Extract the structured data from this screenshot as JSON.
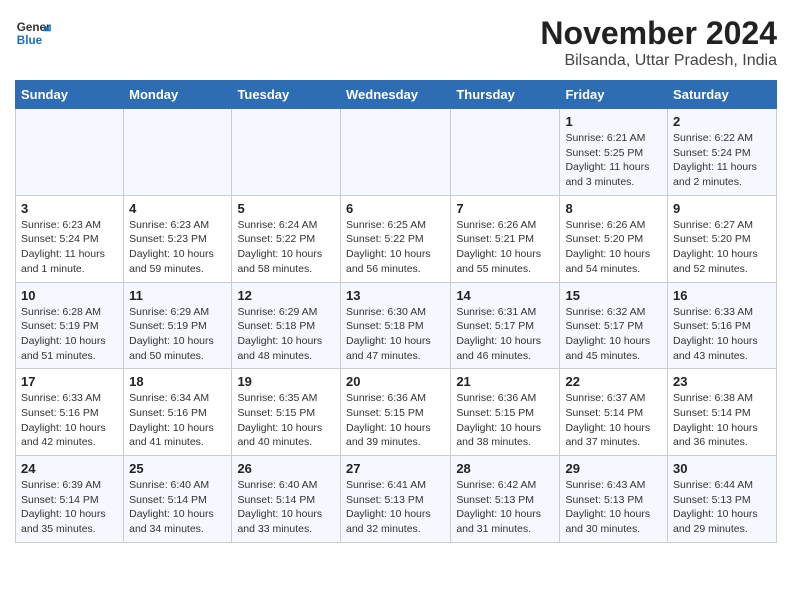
{
  "header": {
    "logo_line1": "General",
    "logo_line2": "Blue",
    "title": "November 2024",
    "subtitle": "Bilsanda, Uttar Pradesh, India"
  },
  "weekdays": [
    "Sunday",
    "Monday",
    "Tuesday",
    "Wednesday",
    "Thursday",
    "Friday",
    "Saturday"
  ],
  "weeks": [
    [
      {
        "num": "",
        "info": ""
      },
      {
        "num": "",
        "info": ""
      },
      {
        "num": "",
        "info": ""
      },
      {
        "num": "",
        "info": ""
      },
      {
        "num": "",
        "info": ""
      },
      {
        "num": "1",
        "info": "Sunrise: 6:21 AM\nSunset: 5:25 PM\nDaylight: 11 hours and 3 minutes."
      },
      {
        "num": "2",
        "info": "Sunrise: 6:22 AM\nSunset: 5:24 PM\nDaylight: 11 hours and 2 minutes."
      }
    ],
    [
      {
        "num": "3",
        "info": "Sunrise: 6:23 AM\nSunset: 5:24 PM\nDaylight: 11 hours and 1 minute."
      },
      {
        "num": "4",
        "info": "Sunrise: 6:23 AM\nSunset: 5:23 PM\nDaylight: 10 hours and 59 minutes."
      },
      {
        "num": "5",
        "info": "Sunrise: 6:24 AM\nSunset: 5:22 PM\nDaylight: 10 hours and 58 minutes."
      },
      {
        "num": "6",
        "info": "Sunrise: 6:25 AM\nSunset: 5:22 PM\nDaylight: 10 hours and 56 minutes."
      },
      {
        "num": "7",
        "info": "Sunrise: 6:26 AM\nSunset: 5:21 PM\nDaylight: 10 hours and 55 minutes."
      },
      {
        "num": "8",
        "info": "Sunrise: 6:26 AM\nSunset: 5:20 PM\nDaylight: 10 hours and 54 minutes."
      },
      {
        "num": "9",
        "info": "Sunrise: 6:27 AM\nSunset: 5:20 PM\nDaylight: 10 hours and 52 minutes."
      }
    ],
    [
      {
        "num": "10",
        "info": "Sunrise: 6:28 AM\nSunset: 5:19 PM\nDaylight: 10 hours and 51 minutes."
      },
      {
        "num": "11",
        "info": "Sunrise: 6:29 AM\nSunset: 5:19 PM\nDaylight: 10 hours and 50 minutes."
      },
      {
        "num": "12",
        "info": "Sunrise: 6:29 AM\nSunset: 5:18 PM\nDaylight: 10 hours and 48 minutes."
      },
      {
        "num": "13",
        "info": "Sunrise: 6:30 AM\nSunset: 5:18 PM\nDaylight: 10 hours and 47 minutes."
      },
      {
        "num": "14",
        "info": "Sunrise: 6:31 AM\nSunset: 5:17 PM\nDaylight: 10 hours and 46 minutes."
      },
      {
        "num": "15",
        "info": "Sunrise: 6:32 AM\nSunset: 5:17 PM\nDaylight: 10 hours and 45 minutes."
      },
      {
        "num": "16",
        "info": "Sunrise: 6:33 AM\nSunset: 5:16 PM\nDaylight: 10 hours and 43 minutes."
      }
    ],
    [
      {
        "num": "17",
        "info": "Sunrise: 6:33 AM\nSunset: 5:16 PM\nDaylight: 10 hours and 42 minutes."
      },
      {
        "num": "18",
        "info": "Sunrise: 6:34 AM\nSunset: 5:16 PM\nDaylight: 10 hours and 41 minutes."
      },
      {
        "num": "19",
        "info": "Sunrise: 6:35 AM\nSunset: 5:15 PM\nDaylight: 10 hours and 40 minutes."
      },
      {
        "num": "20",
        "info": "Sunrise: 6:36 AM\nSunset: 5:15 PM\nDaylight: 10 hours and 39 minutes."
      },
      {
        "num": "21",
        "info": "Sunrise: 6:36 AM\nSunset: 5:15 PM\nDaylight: 10 hours and 38 minutes."
      },
      {
        "num": "22",
        "info": "Sunrise: 6:37 AM\nSunset: 5:14 PM\nDaylight: 10 hours and 37 minutes."
      },
      {
        "num": "23",
        "info": "Sunrise: 6:38 AM\nSunset: 5:14 PM\nDaylight: 10 hours and 36 minutes."
      }
    ],
    [
      {
        "num": "24",
        "info": "Sunrise: 6:39 AM\nSunset: 5:14 PM\nDaylight: 10 hours and 35 minutes."
      },
      {
        "num": "25",
        "info": "Sunrise: 6:40 AM\nSunset: 5:14 PM\nDaylight: 10 hours and 34 minutes."
      },
      {
        "num": "26",
        "info": "Sunrise: 6:40 AM\nSunset: 5:14 PM\nDaylight: 10 hours and 33 minutes."
      },
      {
        "num": "27",
        "info": "Sunrise: 6:41 AM\nSunset: 5:13 PM\nDaylight: 10 hours and 32 minutes."
      },
      {
        "num": "28",
        "info": "Sunrise: 6:42 AM\nSunset: 5:13 PM\nDaylight: 10 hours and 31 minutes."
      },
      {
        "num": "29",
        "info": "Sunrise: 6:43 AM\nSunset: 5:13 PM\nDaylight: 10 hours and 30 minutes."
      },
      {
        "num": "30",
        "info": "Sunrise: 6:44 AM\nSunset: 5:13 PM\nDaylight: 10 hours and 29 minutes."
      }
    ]
  ]
}
